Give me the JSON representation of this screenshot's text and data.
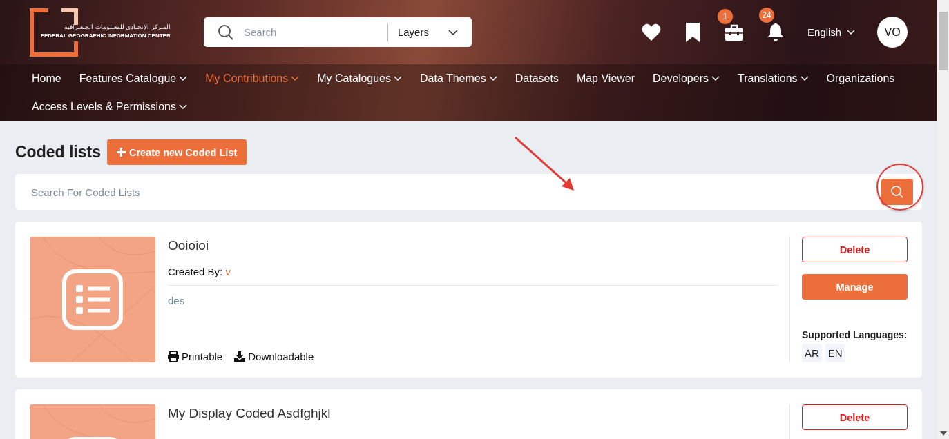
{
  "header": {
    "logo": {
      "arabic": "المـركز الإتحـادي للمعـلومات الجـغـرافية",
      "english": "FEDERAL GEOGRAPHIC INFORMATION CENTER"
    },
    "search": {
      "placeholder": "Search",
      "scope": "Layers"
    },
    "icons": [
      {
        "kind": "heart"
      },
      {
        "kind": "bookmark"
      },
      {
        "kind": "briefcase",
        "badge": "1"
      },
      {
        "kind": "bell",
        "badge": "24"
      }
    ],
    "language": "English",
    "avatar": "VO",
    "nav": [
      {
        "label": "Home",
        "dropdown": false,
        "selected": false
      },
      {
        "label": "Features Catalogue",
        "dropdown": true,
        "selected": false
      },
      {
        "label": "My Contributions",
        "dropdown": true,
        "selected": true
      },
      {
        "label": "My Catalogues",
        "dropdown": true,
        "selected": false
      },
      {
        "label": "Data Themes",
        "dropdown": true,
        "selected": false
      },
      {
        "label": "Datasets",
        "dropdown": false,
        "selected": false
      },
      {
        "label": "Map Viewer",
        "dropdown": false,
        "selected": false
      },
      {
        "label": "Developers",
        "dropdown": true,
        "selected": false
      },
      {
        "label": "Translations",
        "dropdown": true,
        "selected": false
      },
      {
        "label": "Organizations",
        "dropdown": false,
        "selected": false
      },
      {
        "label": "Access Levels & Permissions",
        "dropdown": true,
        "selected": false
      }
    ]
  },
  "page": {
    "title": "Coded lists",
    "create_button": "Create new Coded List",
    "search": {
      "placeholder": "Search For Coded Lists"
    }
  },
  "lists": [
    {
      "title": "Ooioioi",
      "created_by_label": "Created By:",
      "created_by": "v",
      "description": "des",
      "features": [
        "Printable",
        "Downloadable"
      ],
      "delete": "Delete",
      "manage": "Manage",
      "languages_label": "Supported Languages:",
      "languages": [
        "AR",
        "EN"
      ]
    },
    {
      "title": "My Display Coded Asdfghjkl",
      "delete": "Delete"
    }
  ]
}
